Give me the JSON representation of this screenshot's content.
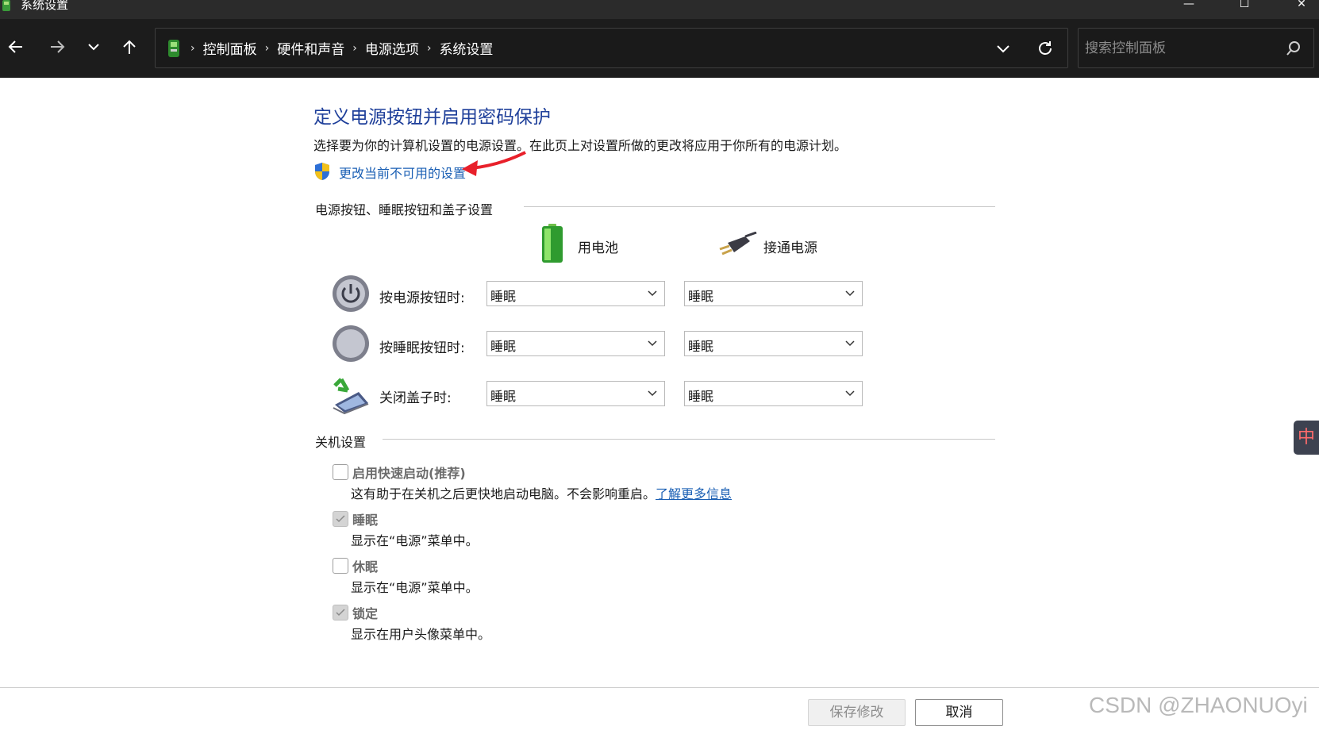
{
  "window": {
    "title": "系统设置",
    "controls": {
      "minimize": "—",
      "maximize": "☐",
      "close": "✕"
    }
  },
  "nav": {
    "breadcrumbs": [
      "控制面板",
      "硬件和声音",
      "电源选项",
      "系统设置"
    ],
    "search_placeholder": "搜索控制面板"
  },
  "page": {
    "title": "定义电源按钮并启用密码保护",
    "description": "选择要为你的计算机设置的电源设置。在此页上对设置所做的更改将应用于你所有的电源计划。",
    "change_link": "更改当前不可用的设置"
  },
  "power_section": {
    "heading": "电源按钮、睡眠按钮和盖子设置",
    "col_battery": "用电池",
    "col_plugged": "接通电源",
    "rows": [
      {
        "label": "按电源按钮时:",
        "battery": "睡眠",
        "plugged": "睡眠",
        "icon": "power-button-icon"
      },
      {
        "label": "按睡眠按钮时:",
        "battery": "睡眠",
        "plugged": "睡眠",
        "icon": "sleep-button-icon"
      },
      {
        "label": "关闭盖子时:",
        "battery": "睡眠",
        "plugged": "睡眠",
        "icon": "laptop-lid-icon"
      }
    ]
  },
  "shutdown_section": {
    "heading": "关机设置",
    "items": [
      {
        "label": "启用快速启动(推荐)",
        "desc": "这有助于在关机之后更快地启动电脑。不会影响重启。",
        "link": "了解更多信息",
        "checked": false
      },
      {
        "label": "睡眠",
        "desc": "显示在“电源”菜单中。",
        "checked": true
      },
      {
        "label": "休眠",
        "desc": "显示在“电源”菜单中。",
        "checked": false
      },
      {
        "label": "锁定",
        "desc": "显示在用户头像菜单中。",
        "checked": true
      }
    ]
  },
  "footer": {
    "save_label": "保存修改",
    "cancel_label": "取消"
  },
  "watermark": "CSDN @ZHAONUOyi",
  "ime_indicator": "中",
  "colors": {
    "title_blue": "#1e3f9a",
    "link_blue": "#1a5fb4",
    "titlebar": "#2b2b2b",
    "navbar": "#1c1c1c"
  }
}
